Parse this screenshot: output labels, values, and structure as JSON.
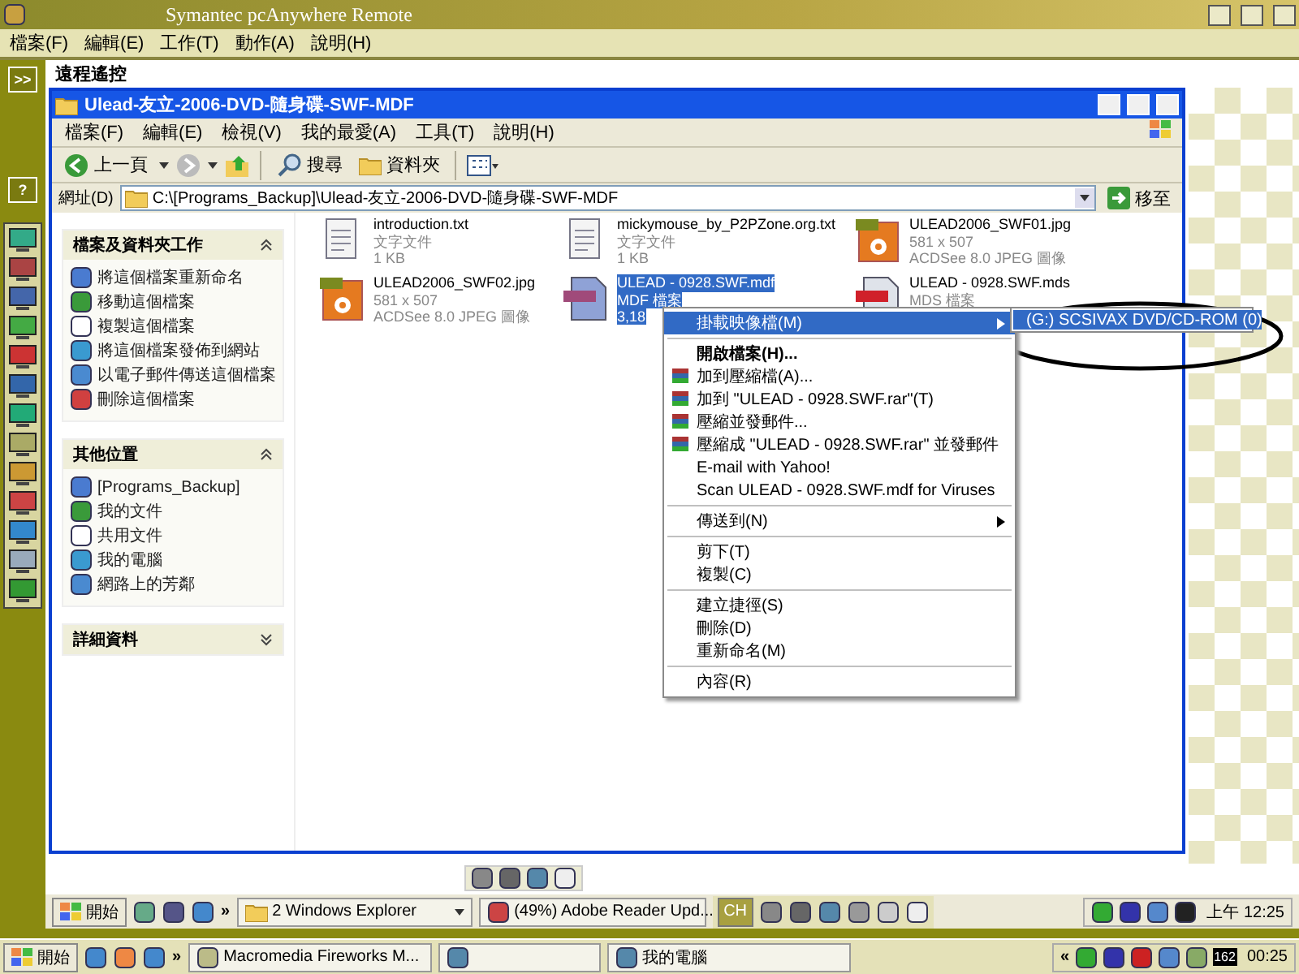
{
  "window": {
    "title": "Symantec pcAnywhere Remote"
  },
  "menu": [
    "檔案(F)",
    "編輯(E)",
    "工作(T)",
    "動作(A)",
    "說明(H)"
  ],
  "side_buttons": [
    ">>",
    "?"
  ],
  "panel_title": "遠程遙控",
  "explorer": {
    "title": "Ulead-友立-2006-DVD-隨身碟-SWF-MDF",
    "menu": [
      "檔案(F)",
      "編輯(E)",
      "檢視(V)",
      "我的最愛(A)",
      "工具(T)",
      "說明(H)"
    ],
    "toolbar": {
      "back": "上一頁",
      "search": "搜尋",
      "folders": "資料夾"
    },
    "address": {
      "label": "網址(D)",
      "value": "C:\\[Programs_Backup]\\Ulead-友立-2006-DVD-隨身碟-SWF-MDF",
      "go": "移至"
    },
    "task_panels": [
      {
        "title": "檔案及資料夾工作",
        "expanded": true,
        "items": [
          "將這個檔案重新命名",
          "移動這個檔案",
          "複製這個檔案",
          "將這個檔案發佈到網站",
          "以電子郵件傳送這個檔案",
          "刪除這個檔案"
        ]
      },
      {
        "title": "其他位置",
        "expanded": true,
        "items": [
          "[Programs_Backup]",
          "我的文件",
          "共用文件",
          "我的電腦",
          "網路上的芳鄰"
        ]
      },
      {
        "title": "詳細資料",
        "expanded": false
      }
    ],
    "files": [
      {
        "name": "introduction.txt",
        "kind": "txt",
        "selected": false,
        "lines": [
          "文字文件",
          "1 KB"
        ]
      },
      {
        "name": "mickymouse_by_P2PZone.org.txt",
        "kind": "txt",
        "selected": false,
        "lines": [
          "文字文件",
          "1 KB"
        ]
      },
      {
        "name": "ULEAD2006_SWF01.jpg",
        "kind": "jpg",
        "selected": false,
        "lines": [
          "581 x 507",
          "ACDSee 8.0 JPEG 圖像"
        ]
      },
      {
        "name": "ULEAD2006_SWF02.jpg",
        "kind": "jpg",
        "selected": false,
        "lines": [
          "581 x 507",
          "ACDSee 8.0 JPEG 圖像"
        ]
      },
      {
        "name": "ULEAD - 0928.SWF.mdf",
        "kind": "mdf",
        "selected": true,
        "lines": [
          "MDF 檔案",
          "3,18"
        ]
      },
      {
        "name": "ULEAD - 0928.SWF.mds",
        "kind": "mds",
        "selected": false,
        "lines": [
          "MDS 檔案"
        ]
      }
    ],
    "context_menu": {
      "groups": [
        {
          "items": [
            {
              "label": "掛載映像檔(M)",
              "kind": "plain",
              "selected": true,
              "submenu": true
            }
          ]
        },
        {
          "items": [
            {
              "label": "開啟檔案(H)...",
              "kind": "default",
              "selected": false,
              "submenu": false
            },
            {
              "label": "加到壓縮檔(A)...",
              "kind": "archive",
              "selected": false,
              "submenu": false
            },
            {
              "label": "加到 \"ULEAD - 0928.SWF.rar\"(T)",
              "kind": "archive",
              "selected": false,
              "submenu": false
            },
            {
              "label": "壓縮並發郵件...",
              "kind": "archive",
              "selected": false,
              "submenu": false
            },
            {
              "label": "壓縮成 \"ULEAD - 0928.SWF.rar\" 並發郵件",
              "kind": "archive",
              "selected": false,
              "submenu": false
            },
            {
              "label": "E-mail with Yahoo!",
              "kind": "plain",
              "selected": false,
              "submenu": false
            },
            {
              "label": "Scan ULEAD - 0928.SWF.mdf for Viruses",
              "kind": "plain",
              "selected": false,
              "submenu": false
            }
          ]
        },
        {
          "items": [
            {
              "label": "傳送到(N)",
              "kind": "plain",
              "selected": false,
              "submenu": true
            }
          ]
        },
        {
          "items": [
            {
              "label": "剪下(T)",
              "kind": "plain",
              "selected": false,
              "submenu": false
            },
            {
              "label": "複製(C)",
              "kind": "plain",
              "selected": false,
              "submenu": false
            }
          ]
        },
        {
          "items": [
            {
              "label": "建立捷徑(S)",
              "kind": "plain",
              "selected": false,
              "submenu": false
            },
            {
              "label": "刪除(D)",
              "kind": "plain",
              "selected": false,
              "submenu": false
            },
            {
              "label": "重新命名(M)",
              "kind": "plain",
              "selected": false,
              "submenu": false
            }
          ]
        },
        {
          "items": [
            {
              "label": "內容(R)",
              "kind": "plain",
              "selected": false,
              "submenu": false
            }
          ]
        }
      ]
    },
    "submenu": {
      "label": "(G:) SCSIVAX DVD/CD-ROM (0)",
      "selected": true
    }
  },
  "remote_taskbar": {
    "start": "開始",
    "more": "»",
    "tasks": [
      {
        "label": "2 Windows Explorer",
        "kind": "group"
      },
      {
        "label": "(49%) Adobe Reader Upd...",
        "kind": "single"
      }
    ],
    "language": "CH",
    "clock": "上午 12:25"
  },
  "taskbar": {
    "start": "開始",
    "more": "»",
    "tasks": [
      {
        "label": "Macromedia Fireworks M...",
        "kind": "labeled"
      },
      {
        "kind": "blank"
      },
      {
        "label": "我的電腦",
        "kind": "labeled"
      }
    ],
    "tray_expand": "«",
    "tray_badge": "162",
    "clock": "00:25"
  }
}
